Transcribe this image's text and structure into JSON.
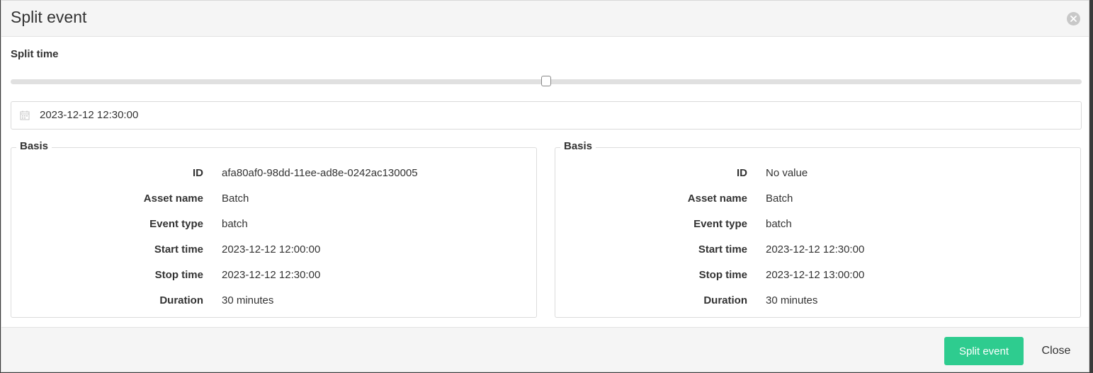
{
  "modal": {
    "title": "Split event",
    "close_icon": "close-circle-icon"
  },
  "split_time": {
    "label": "Split time",
    "slider_fraction": 0.5,
    "date_value": "2023-12-12 12:30:00",
    "calendar_icon": "calendar-icon"
  },
  "panels": [
    {
      "legend": "Basis",
      "rows": [
        {
          "key": "ID",
          "value": "afa80af0-98dd-11ee-ad8e-0242ac130005"
        },
        {
          "key": "Asset name",
          "value": "Batch"
        },
        {
          "key": "Event type",
          "value": "batch"
        },
        {
          "key": "Start time",
          "value": "2023-12-12 12:00:00"
        },
        {
          "key": "Stop time",
          "value": "2023-12-12 12:30:00"
        },
        {
          "key": "Duration",
          "value": "30 minutes"
        }
      ]
    },
    {
      "legend": "Basis",
      "rows": [
        {
          "key": "ID",
          "value": "No value"
        },
        {
          "key": "Asset name",
          "value": "Batch"
        },
        {
          "key": "Event type",
          "value": "batch"
        },
        {
          "key": "Start time",
          "value": "2023-12-12 12:30:00"
        },
        {
          "key": "Stop time",
          "value": "2023-12-12 13:00:00"
        },
        {
          "key": "Duration",
          "value": "30 minutes"
        }
      ]
    }
  ],
  "footer": {
    "split_label": "Split event",
    "close_label": "Close"
  },
  "colors": {
    "primary": "#2ecc8f",
    "header_bg": "#f5f5f5"
  }
}
